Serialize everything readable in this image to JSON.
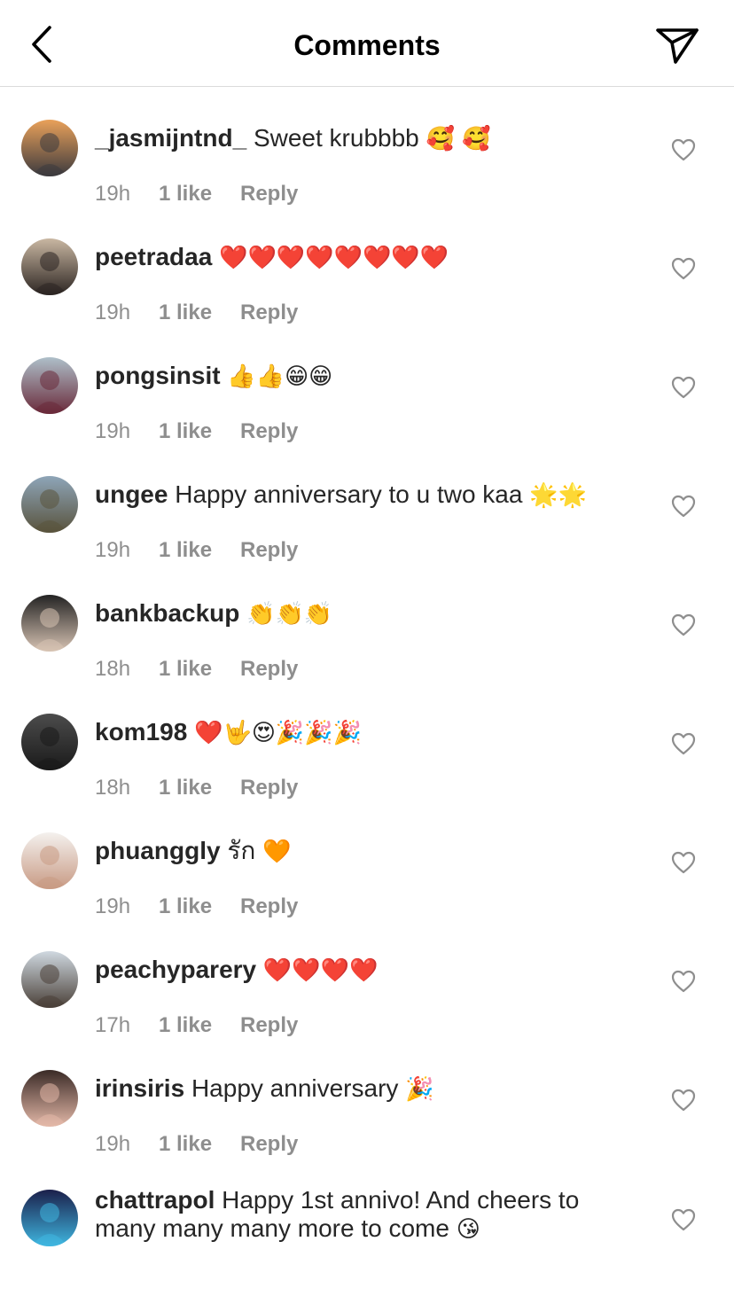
{
  "header": {
    "title": "Comments",
    "back_icon": "chevron-left-icon",
    "share_icon": "send-icon"
  },
  "reply_label": "Reply",
  "comments": [
    {
      "username": "_jasmijntnd_",
      "text": "Sweet krubbbb",
      "emoji": "🥰 🥰",
      "time": "19h",
      "likes": "1 like",
      "avatar_colors": [
        "#e9a15a",
        "#3c3a3e"
      ]
    },
    {
      "username": "peetradaa",
      "text": "",
      "emoji": "❤️❤️❤️❤️❤️❤️❤️❤️",
      "time": "19h",
      "likes": "1 like",
      "avatar_colors": [
        "#c9b7a2",
        "#2c2522"
      ]
    },
    {
      "username": "pongsinsit",
      "text": "",
      "emoji": "👍👍😁😁",
      "time": "19h",
      "likes": "1 like",
      "avatar_colors": [
        "#aebfc9",
        "#6a2a3a"
      ]
    },
    {
      "username": "ungee",
      "text": "Happy anniversary to u two kaa",
      "emoji": "🌟🌟",
      "time": "19h",
      "likes": "1 like",
      "avatar_colors": [
        "#8ea5b8",
        "#59533d"
      ]
    },
    {
      "username": "bankbackup",
      "text": "",
      "emoji": "👏👏👏",
      "time": "18h",
      "likes": "1 like",
      "avatar_colors": [
        "#232323",
        "#d7c3b3"
      ]
    },
    {
      "username": "kom198",
      "text": "",
      "emoji": "❤️🤟😍🎉🎉🎉",
      "time": "18h",
      "likes": "1 like",
      "avatar_colors": [
        "#4c4c4c",
        "#1a1a1a"
      ]
    },
    {
      "username": "phuanggly",
      "text": "รัก",
      "emoji": "🧡",
      "time": "19h",
      "likes": "1 like",
      "avatar_colors": [
        "#f4f1ee",
        "#c89a84"
      ]
    },
    {
      "username": "peachyparery",
      "text": "",
      "emoji": "❤️❤️❤️❤️",
      "time": "17h",
      "likes": "1 like",
      "avatar_colors": [
        "#cfd8e0",
        "#4a4038"
      ]
    },
    {
      "username": "irinsiris",
      "text": "Happy anniversary",
      "emoji": "🎉",
      "time": "19h",
      "likes": "1 like",
      "avatar_colors": [
        "#3a2a26",
        "#e3b8a8"
      ]
    },
    {
      "username": "chattrapol",
      "text": "Happy 1st annivo! And cheers to many many many more to come",
      "emoji": "😘",
      "time": "",
      "likes": "",
      "avatar_colors": [
        "#1b1f4a",
        "#3fb6e0"
      ]
    }
  ]
}
